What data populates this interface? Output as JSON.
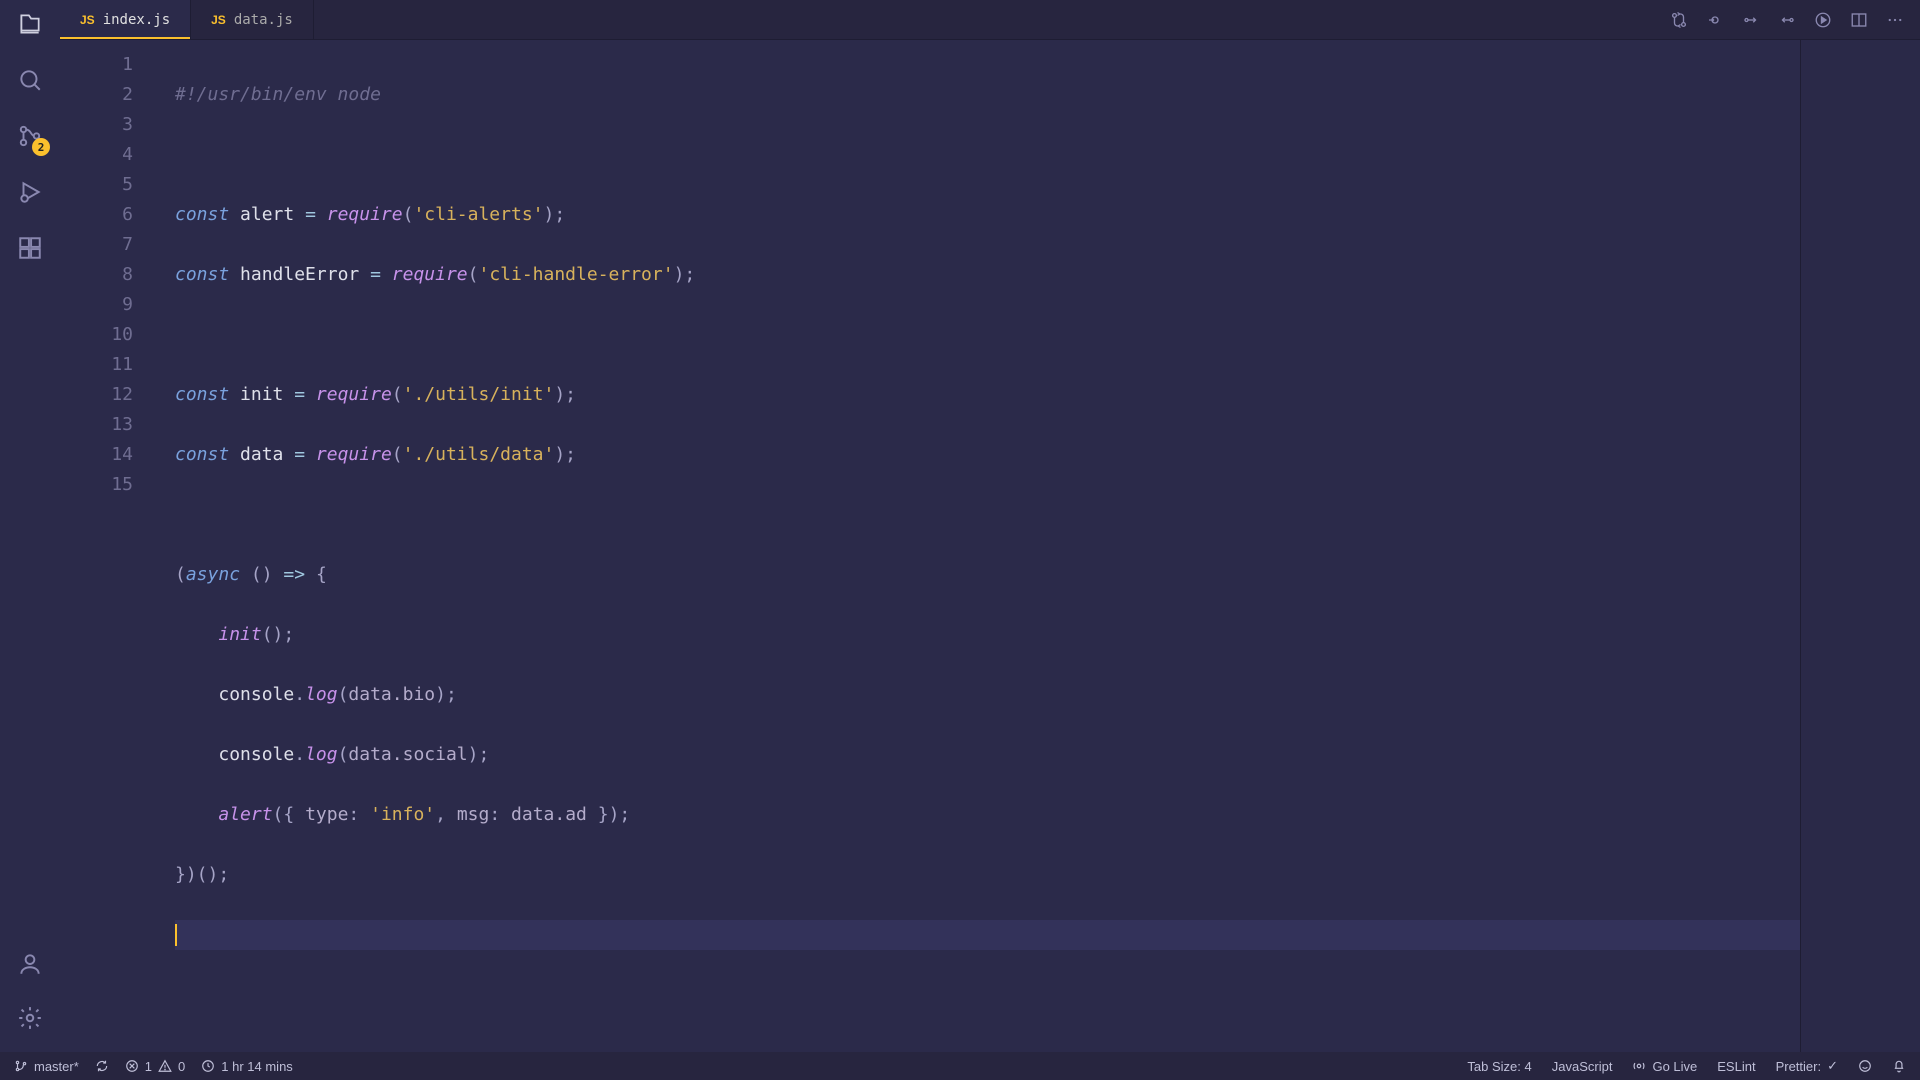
{
  "tabs": [
    {
      "icon": "JS",
      "label": "index.js",
      "active": true
    },
    {
      "icon": "JS",
      "label": "data.js",
      "active": false
    }
  ],
  "activity_badge": "2",
  "code": {
    "lines": [
      "1",
      "2",
      "3",
      "4",
      "5",
      "6",
      "7",
      "8",
      "9",
      "10",
      "11",
      "12",
      "13",
      "14",
      "15"
    ],
    "l1_shebang": "#!/usr/bin/env node",
    "const": "const",
    "require": "require",
    "async": "async",
    "l3_var": "alert",
    "l3_str": "'cli-alerts'",
    "l4_var": "handleError",
    "l4_str": "'cli-handle-error'",
    "l6_var": "init",
    "l6_str": "'./utils/init'",
    "l7_var": "data",
    "l7_str": "'./utils/data'",
    "l10_call": "init",
    "log": "log",
    "console": "console",
    "l11_prop": "data.bio",
    "l12_prop": "data.social",
    "l13_type_key": "type",
    "l13_type_val": "'info'",
    "l13_msg_key": "msg",
    "l13_msg_val": "data.ad",
    "l13_alert": "alert"
  },
  "status": {
    "branch": "master*",
    "errors": "1",
    "warnings": "0",
    "time": "1 hr 14 mins",
    "tab_size": "Tab Size: 4",
    "language": "JavaScript",
    "go_live": "Go Live",
    "eslint": "ESLint",
    "prettier": "Prettier: ",
    "prettier_check": "✓"
  }
}
